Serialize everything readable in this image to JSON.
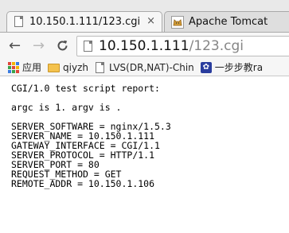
{
  "tabs": [
    {
      "title": "10.150.1.111/123.cgi",
      "close": "×",
      "active": true
    },
    {
      "title": "Apache Tomcat",
      "active": false
    }
  ],
  "toolbar": {
    "back": "←",
    "forward": "→",
    "reload": "C",
    "url_host": "10.150.1.111",
    "url_path": "/123.cgi"
  },
  "bookmarks": [
    {
      "label": "应用",
      "icon": "apps-icon"
    },
    {
      "label": "qiyzh",
      "icon": "folder-icon"
    },
    {
      "label": "LVS(DR,NAT)-Chin",
      "icon": "page-icon"
    },
    {
      "label": "一步步教ra",
      "icon": "paw-icon"
    }
  ],
  "content": {
    "heading": "CGI/1.0 test script report:",
    "args": "argc is 1. argv is .",
    "env": [
      "SERVER_SOFTWARE = nginx/1.5.3",
      "SERVER_NAME = 10.150.1.111",
      "GATEWAY_INTERFACE = CGI/1.1",
      "SERVER_PROTOCOL = HTTP/1.1",
      "SERVER_PORT = 80",
      "REQUEST_METHOD = GET",
      "REMOTE_ADDR = 10.150.1.106"
    ]
  },
  "colors": {
    "tab_strip": "#e9e9e9",
    "toolbar": "#f6f6f6",
    "url_path": "#858585",
    "folder": "#f4c24d",
    "paw_bg": "#2a3d9e"
  }
}
